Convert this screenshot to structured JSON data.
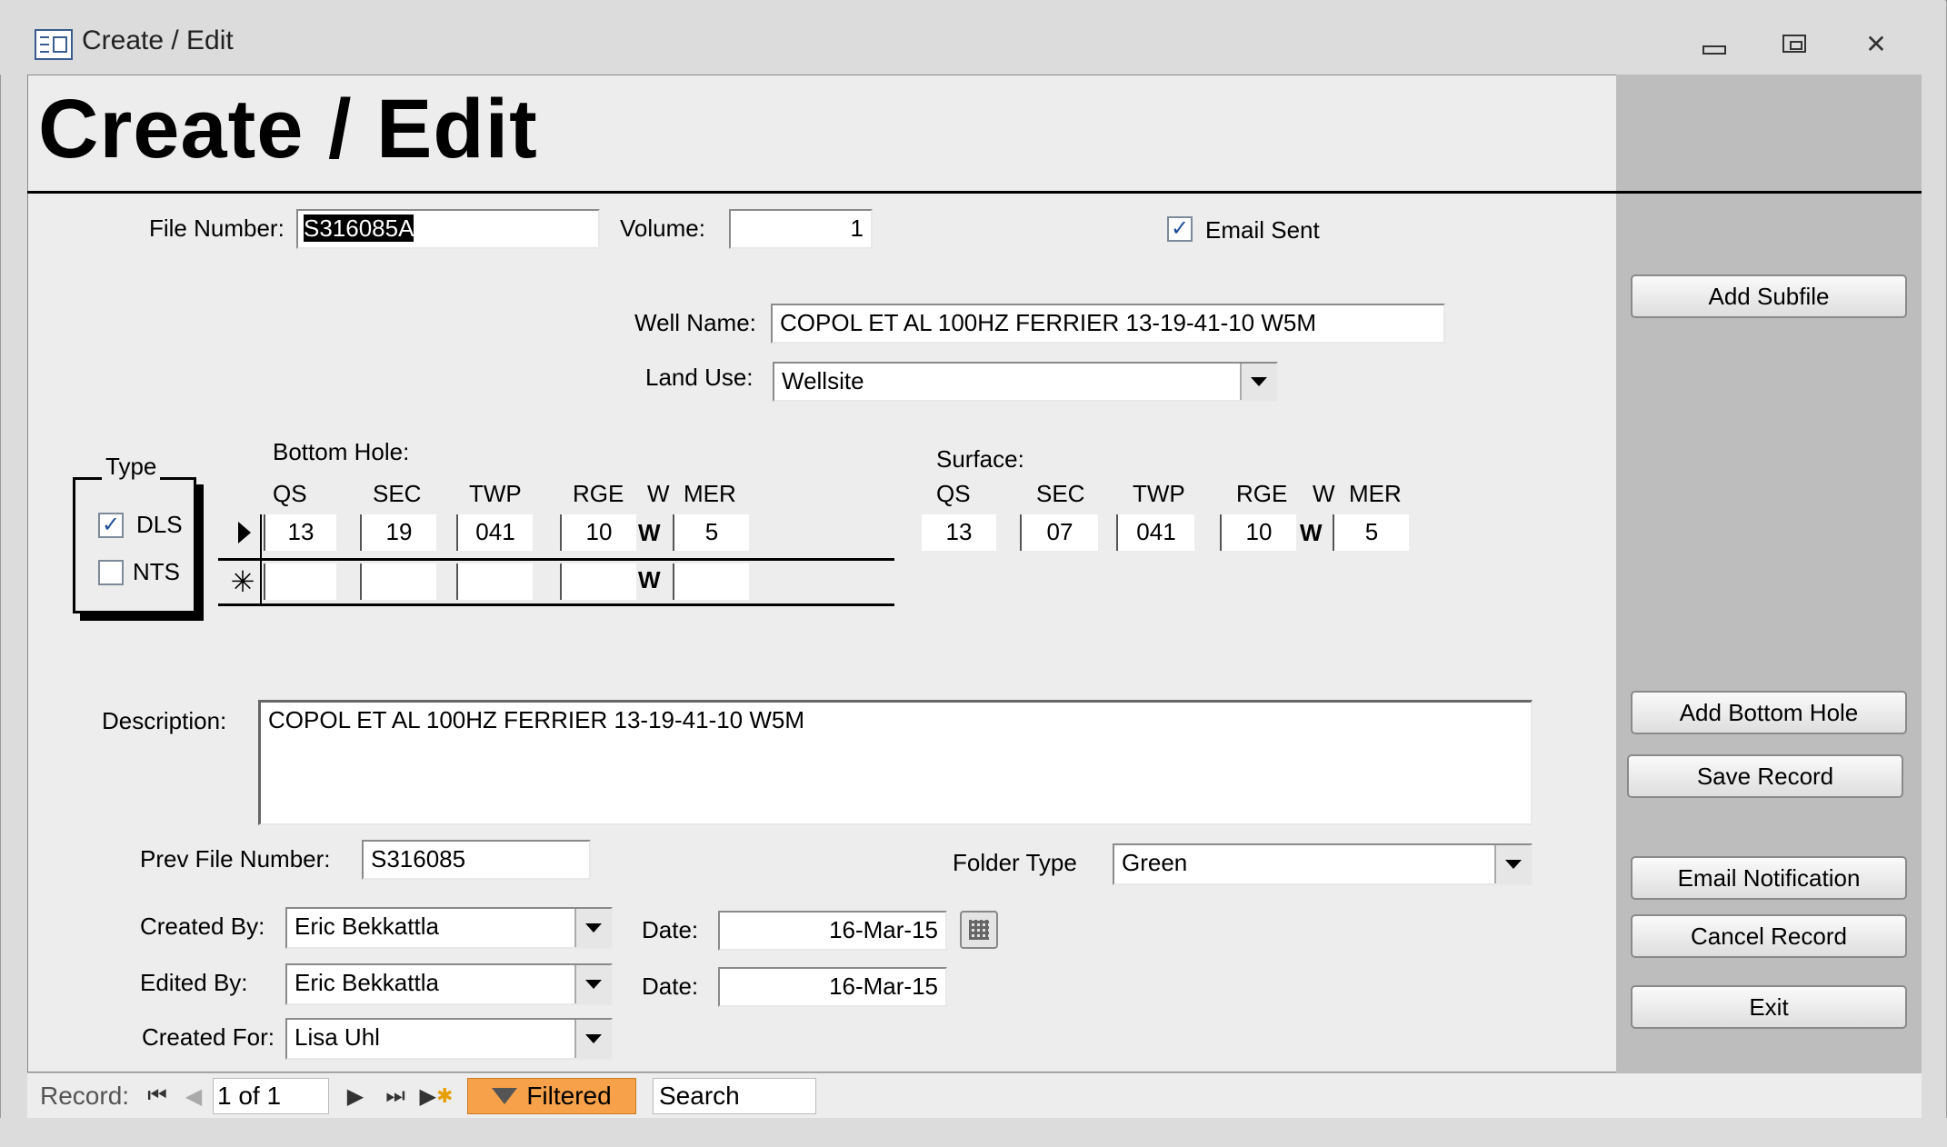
{
  "window": {
    "title": "Create / Edit"
  },
  "form": {
    "heading": "Create / Edit",
    "file_number": {
      "label": "File Number:",
      "value": "S316085A"
    },
    "volume": {
      "label": "Volume:",
      "value": "1"
    },
    "email_sent": {
      "label": "Email Sent",
      "checked": true
    },
    "well_name": {
      "label": "Well Name:",
      "value": "COPOL ET AL 100HZ FERRIER 13-19-41-10 W5M"
    },
    "land_use": {
      "label": "Land Use:",
      "value": "Wellsite"
    },
    "type": {
      "label": "Type",
      "dls": {
        "label": "DLS",
        "checked": true
      },
      "nts": {
        "label": "NTS",
        "checked": false
      }
    },
    "bottom_hole": {
      "label": "Bottom Hole:",
      "headers": [
        "QS",
        "SEC",
        "TWP",
        "RGE",
        "W",
        "MER"
      ],
      "row": {
        "qs": "13",
        "sec": "19",
        "twp": "041",
        "rge": "10",
        "w": "W",
        "mer": "5"
      },
      "new_row_w": "W"
    },
    "surface": {
      "label": "Surface:",
      "headers": [
        "QS",
        "SEC",
        "TWP",
        "RGE",
        "W",
        "MER"
      ],
      "row": {
        "qs": "13",
        "sec": "07",
        "twp": "041",
        "rge": "10",
        "w": "W",
        "mer": "5"
      }
    },
    "description": {
      "label": "Description:",
      "value": "COPOL ET AL 100HZ FERRIER 13-19-41-10 W5M"
    },
    "prev_file_number": {
      "label": "Prev File Number:",
      "value": "S316085"
    },
    "folder_type": {
      "label": "Folder Type",
      "value": "Green"
    },
    "created_by": {
      "label": "Created By:",
      "value": "Eric Bekkattla"
    },
    "created_date": {
      "label": "Date:",
      "value": "16-Mar-15"
    },
    "edited_by": {
      "label": "Edited By:",
      "value": "Eric Bekkattla"
    },
    "edited_date": {
      "label": "Date:",
      "value": "16-Mar-15"
    },
    "created_for": {
      "label": "Created For:",
      "value": "Lisa Uhl"
    }
  },
  "buttons": {
    "add_subfile": "Add Subfile",
    "add_bottom_hole": "Add Bottom Hole",
    "save_record": "Save Record",
    "email_notification": "Email Notification",
    "cancel_record": "Cancel Record",
    "exit": "Exit"
  },
  "navbar": {
    "record_label": "Record:",
    "record_value": "1 of 1",
    "filter_label": "Filtered",
    "search_label": "Search",
    "filter_color": "#f7a24a"
  }
}
